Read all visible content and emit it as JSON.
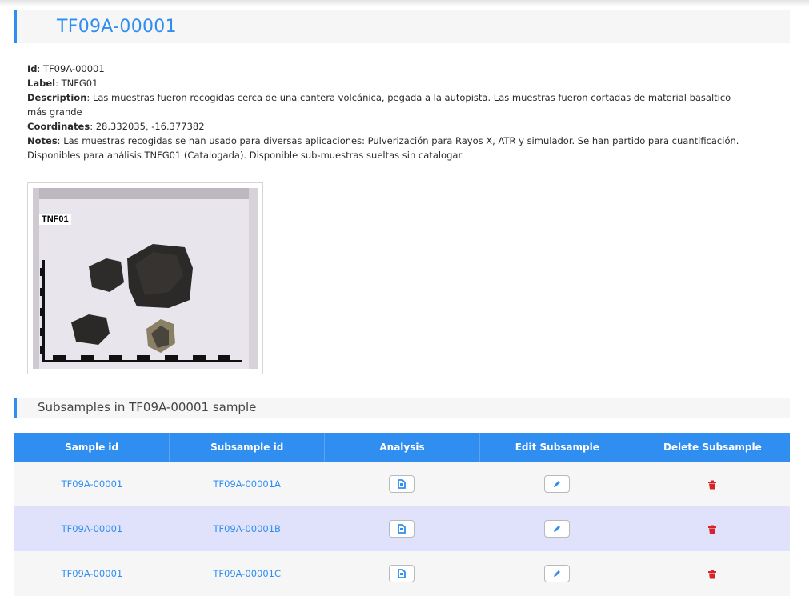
{
  "header": {
    "title": "TF09A-00001"
  },
  "details": {
    "id_label": "Id",
    "id_value": ": TF09A-00001",
    "label_label": "Label",
    "label_value": ": TNFG01",
    "description_label": "Description",
    "description_value": ": Las muestras fueron recogidas cerca de una cantera volcánica, pegada a la autopista. Las muestras fueron cortadas de material basaltico más grande",
    "coordinates_label": "Coordinates",
    "coordinates_value": ": 28.332035, -16.377382",
    "notes_label": "Notes",
    "notes_value": ": Las muestras recogidas se han usado para diversas aplicaciones: Pulverización para Rayos X, ATR y simulador. Se han partido para cuantificación. Disponibles para análisis TNFG01 (Catalogada). Disponible sub-muestras sueltas sin catalogar"
  },
  "photo": {
    "tag": "TNF01"
  },
  "subsamples": {
    "section_title": "Subsamples in TF09A-00001 sample",
    "columns": [
      "Sample id",
      "Subsample id",
      "Analysis",
      "Edit Subsample",
      "Delete Subsample"
    ],
    "rows": [
      {
        "sample_id": "TF09A-00001",
        "subsample_id": "TF09A-00001A"
      },
      {
        "sample_id": "TF09A-00001",
        "subsample_id": "TF09A-00001B"
      },
      {
        "sample_id": "TF09A-00001",
        "subsample_id": "TF09A-00001C"
      }
    ]
  },
  "colors": {
    "accent": "#2f8ef0",
    "row_alt": "#dfe2fa",
    "delete": "#d9232a"
  },
  "icons": {
    "analysis": "document-icon",
    "edit": "pencil-icon",
    "delete": "trash-icon"
  }
}
